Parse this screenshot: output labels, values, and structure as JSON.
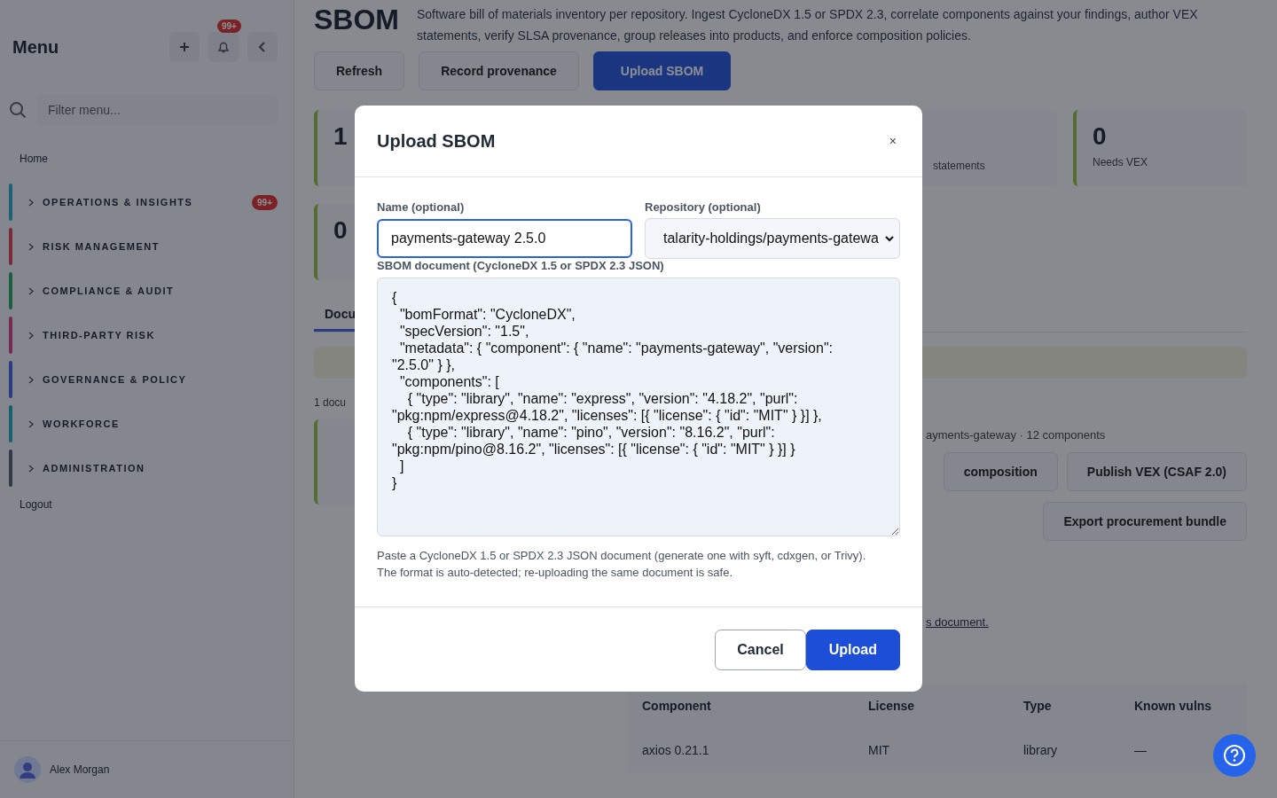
{
  "sidebar": {
    "title": "Menu",
    "notifications_badge": "99+",
    "filter": {
      "placeholder": "Filter menu..."
    },
    "home": "Home",
    "groups": [
      {
        "label": "OPERATIONS & INSIGHTS",
        "color": "#1e6176",
        "badge": "99+"
      },
      {
        "label": "RISK MANAGEMENT",
        "color": "#7b2a37"
      },
      {
        "label": "COMPLIANCE & AUDIT",
        "color": "#1c5e3f"
      },
      {
        "label": "THIRD-PARTY RISK",
        "color": "#782956"
      },
      {
        "label": "GOVERNANCE & POLICY",
        "color": "#2a3d82"
      },
      {
        "label": "WORKFORCE",
        "color": "#186070"
      },
      {
        "label": "ADMINISTRATION",
        "color": "#323a46"
      }
    ],
    "logout": "Logout",
    "user": "Alex Morgan"
  },
  "page": {
    "title": "SBOM",
    "description": "Software bill of materials inventory per repository. Ingest CycloneDX 1.5 or SPDX 2.3, correlate components against your findings, author VEX statements, verify SLSA provenance, group releases into products, and enforce composition policies.",
    "actions": [
      {
        "label": "Refresh",
        "primary": false
      },
      {
        "label": "Record provenance",
        "primary": false
      },
      {
        "label": "Upload SBOM",
        "primary": true
      }
    ],
    "stats": [
      {
        "value": "1"
      },
      {
        "label": "statements"
      },
      {
        "value": "0",
        "label": "Needs VEX"
      },
      {
        "value": "0"
      }
    ],
    "tab": "Docu",
    "count_text": "1 docu",
    "repo_summary": "ayments-gateway · 12 components",
    "side_actions": [
      "composition",
      "Publish VEX (CSAF 2.0)"
    ],
    "export_button": "Export procurement bundle",
    "note_link": "s document.",
    "table": {
      "columns": [
        "Component",
        "License",
        "Type",
        "Known vulns"
      ],
      "rows": [
        [
          "axios 0.21.1",
          "MIT",
          "library",
          "—"
        ]
      ]
    }
  },
  "dialog": {
    "title": "Upload SBOM",
    "close": "×",
    "name_field": {
      "label": "Name (optional)",
      "value": "payments-gateway 2.5.0"
    },
    "repo_field": {
      "label": "Repository (optional)",
      "value": "talarity-holdings/payments-gatewa"
    },
    "document_field": {
      "label": "SBOM document (CycloneDX 1.5 or SPDX 2.3 JSON)",
      "value": "{\n  \"bomFormat\": \"CycloneDX\",\n  \"specVersion\": \"1.5\",\n  \"metadata\": { \"component\": { \"name\": \"payments-gateway\", \"version\": \"2.5.0\" } },\n  \"components\": [\n    { \"type\": \"library\", \"name\": \"express\", \"version\": \"4.18.2\", \"purl\": \"pkg:npm/express@4.18.2\", \"licenses\": [{ \"license\": { \"id\": \"MIT\" } }] },\n    { \"type\": \"library\", \"name\": \"pino\", \"version\": \"8.16.2\", \"purl\": \"pkg:npm/pino@8.16.2\", \"licenses\": [{ \"license\": { \"id\": \"MIT\" } }] }\n  ]\n}"
    },
    "hint": "Paste a CycloneDX 1.5 or SPDX 2.3 JSON document (generate one with syft, cdxgen, or Trivy). The format is auto-detected; re-uploading the same document is safe.",
    "buttons": [
      {
        "label": "Cancel",
        "primary": false
      },
      {
        "label": "Upload",
        "primary": true
      }
    ]
  }
}
